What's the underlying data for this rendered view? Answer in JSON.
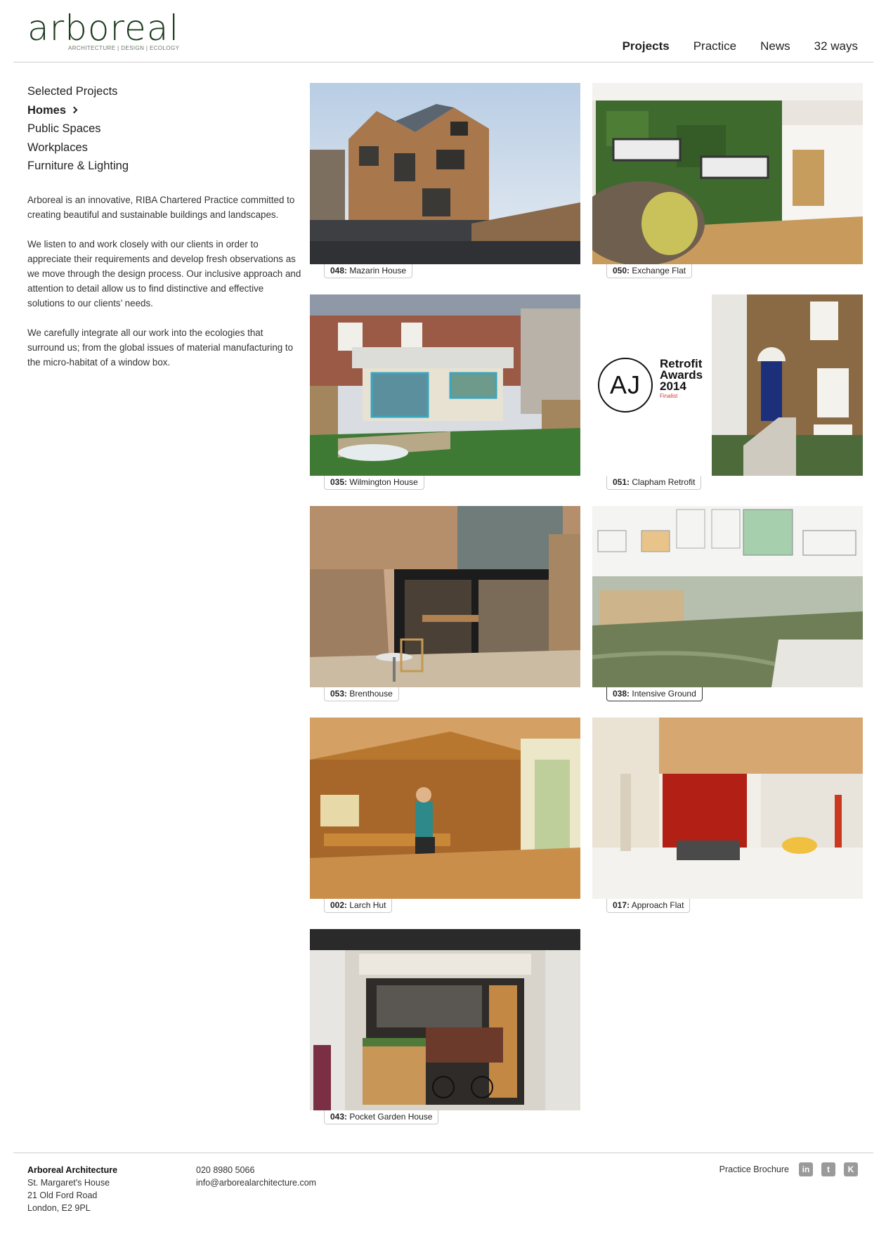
{
  "brand": {
    "name": "arboreal",
    "tagline": "ARCHITECTURE | DESIGN | ECOLOGY",
    "color": "#1c3b1f"
  },
  "nav": [
    {
      "label": "Projects",
      "active": true
    },
    {
      "label": "Practice"
    },
    {
      "label": "News"
    },
    {
      "label": "32 ways"
    }
  ],
  "sidebar": {
    "categories": [
      {
        "label": "Selected Projects"
      },
      {
        "label": "Homes",
        "active": true,
        "icon": "chevron-right-icon"
      },
      {
        "label": "Public Spaces"
      },
      {
        "label": "Workplaces"
      },
      {
        "label": "Furniture & Lighting"
      }
    ],
    "intro": [
      "Arboreal is an innovative, RIBA Chartered Practice committed to creating beautiful and sustainable buildings and landscapes.",
      "We listen to and work closely with our clients in order to appreciate their requirements and develop fresh observations as we move through the design process. Our inclusive approach and attention to detail allow us to find distinctive and effective solutions to our clients’ needs.",
      "We carefully integrate all our work into the ecologies that surround us; from the global issues of material manufacturing to the micro-habitat of a window box."
    ]
  },
  "projects": [
    {
      "number": "048:",
      "name": "Mazarin House"
    },
    {
      "number": "050:",
      "name": "Exchange Flat"
    },
    {
      "number": "035:",
      "name": "Wilmington House"
    },
    {
      "number": "051:",
      "name": "Clapham Retrofit",
      "badge": {
        "logo": "AJ",
        "line1": "Retrofit",
        "line2": "Awards",
        "line3": "2014",
        "line4": "Finalist"
      }
    },
    {
      "number": "053:",
      "name": "Brenthouse"
    },
    {
      "number": "038:",
      "name": "Intensive Ground"
    },
    {
      "number": "002:",
      "name": "Larch Hut"
    },
    {
      "number": "017:",
      "name": "Approach Flat"
    },
    {
      "number": "043:",
      "name": "Pocket Garden House"
    }
  ],
  "footer": {
    "company": "Arboreal Architecture",
    "address": [
      "St. Margaret's House",
      "21 Old Ford Road",
      "London, E2 9PL"
    ],
    "phone": "020 8980 5066",
    "email": "info@arborealarchitecture.com",
    "brochure": "Practice Brochure",
    "social": [
      {
        "icon": "linkedin-icon",
        "glyph": "in"
      },
      {
        "icon": "twitter-icon",
        "glyph": "t"
      },
      {
        "icon": "kickstarter-icon",
        "glyph": "K"
      }
    ]
  }
}
